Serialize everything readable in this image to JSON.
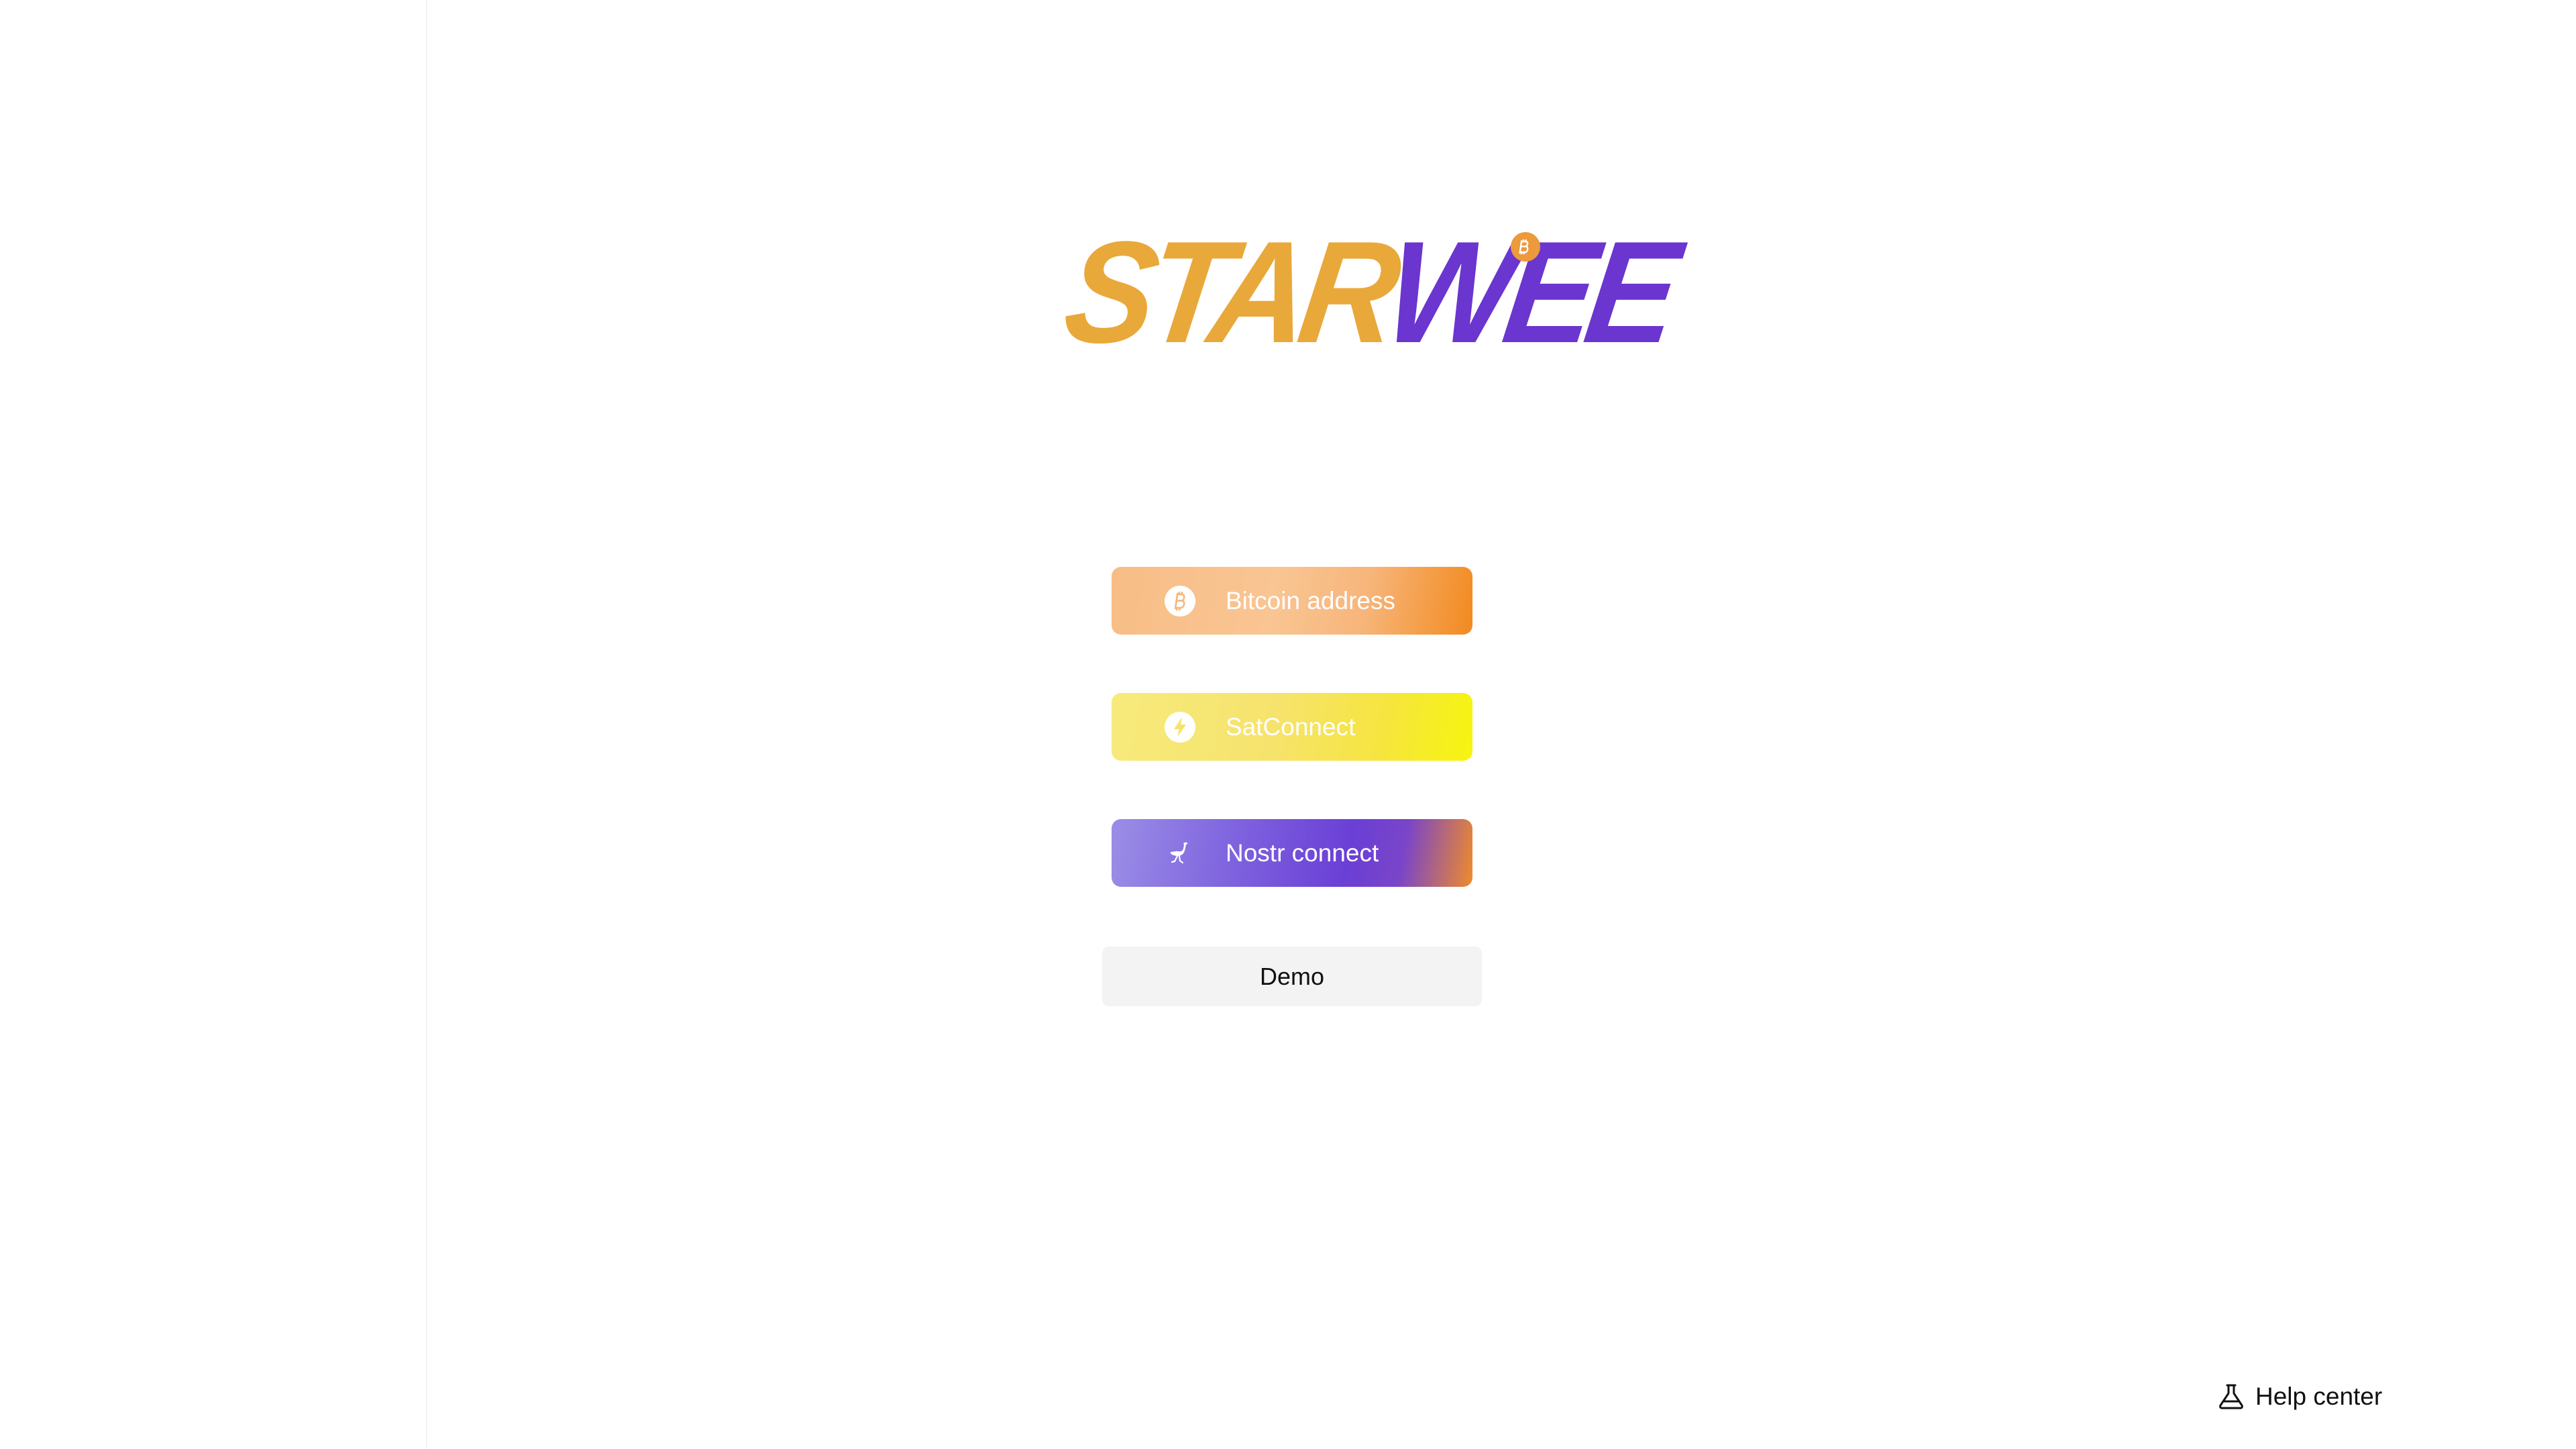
{
  "app": {
    "logo": {
      "part1": "STAR",
      "part2": "WEE",
      "badge_icon": "bitcoin-icon"
    }
  },
  "login": {
    "buttons": [
      {
        "label": "Bitcoin address",
        "icon": "bitcoin-icon"
      },
      {
        "label": "SatConnect",
        "icon": "lightning-icon"
      },
      {
        "label": "Nostr connect",
        "icon": "ostrich-icon"
      }
    ],
    "demo_label": "Demo"
  },
  "footer": {
    "help_label": "Help center",
    "help_icon": "flask-icon"
  },
  "colors": {
    "logo_star": "#e9a83a",
    "logo_wee": "#6b35cf",
    "bitcoin_orange": "#f28a1f",
    "sat_yellow": "#f6f50e",
    "nostr_purple": "#6a3fd6"
  }
}
